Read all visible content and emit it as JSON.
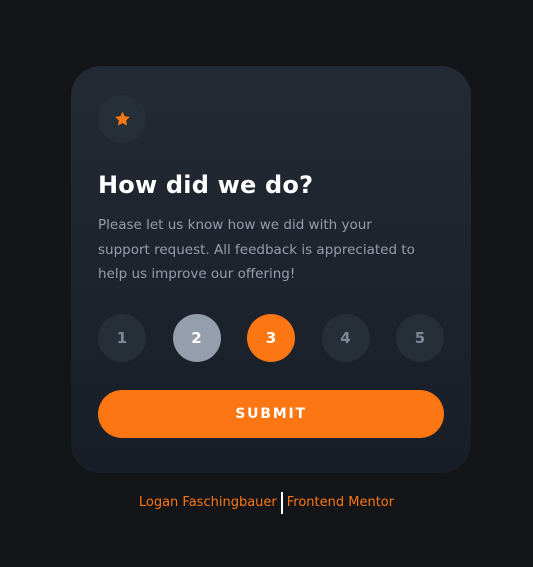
{
  "card": {
    "title": "How did we do?",
    "description": "Please let us know how we did with your support request. All feedback is appreciated to help us improve our offering!",
    "star_icon": "star-icon",
    "ratings": [
      {
        "label": "1",
        "state": "default"
      },
      {
        "label": "2",
        "state": "hovered"
      },
      {
        "label": "3",
        "state": "selected"
      },
      {
        "label": "4",
        "state": "default"
      },
      {
        "label": "5",
        "state": "default"
      }
    ],
    "selected_rating": 3,
    "submit_label": "SUBMIT"
  },
  "attribution": {
    "author": "Logan Faschingbauer",
    "site": "Frontend Mentor"
  },
  "colors": {
    "background": "#131518",
    "accent": "#fc7614",
    "card_top": "#232a34",
    "card_bottom": "#181e27",
    "rating_bg": "#262e38",
    "rating_hover": "#959eac",
    "text_muted": "#959eac"
  }
}
